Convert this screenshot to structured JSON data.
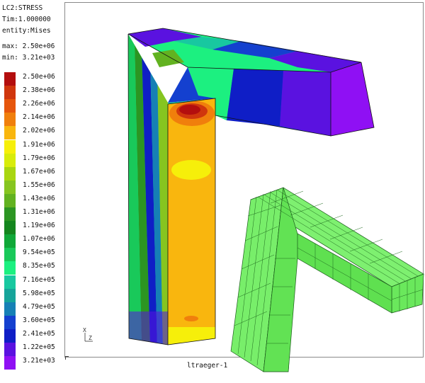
{
  "header": {
    "loadcase": "LC2:STRESS",
    "time": "Tim:1.000000",
    "entity": "entity:Mises",
    "max": "max: 2.50e+06",
    "min": "min: 3.21e+03"
  },
  "legend": {
    "items": [
      {
        "label": "2.50e+06",
        "color": "#b30e0e"
      },
      {
        "label": "2.38e+06",
        "color": "#d0360d"
      },
      {
        "label": "2.26e+06",
        "color": "#e6560c"
      },
      {
        "label": "2.14e+06",
        "color": "#f07f0c"
      },
      {
        "label": "2.02e+06",
        "color": "#f9b60e"
      },
      {
        "label": "1.91e+06",
        "color": "#f6ef0a"
      },
      {
        "label": "1.79e+06",
        "color": "#d8ec0a"
      },
      {
        "label": "1.67e+06",
        "color": "#a9d610"
      },
      {
        "label": "1.55e+06",
        "color": "#86c520"
      },
      {
        "label": "1.43e+06",
        "color": "#62b220"
      },
      {
        "label": "1.31e+06",
        "color": "#2c9522"
      },
      {
        "label": "1.19e+06",
        "color": "#14861e"
      },
      {
        "label": "1.07e+06",
        "color": "#10a838"
      },
      {
        "label": "9.54e+05",
        "color": "#19c95a"
      },
      {
        "label": "8.35e+05",
        "color": "#1cf080"
      },
      {
        "label": "7.16e+05",
        "color": "#18c8a0"
      },
      {
        "label": "5.98e+05",
        "color": "#16a49a"
      },
      {
        "label": "4.79e+05",
        "color": "#1680b5"
      },
      {
        "label": "3.60e+05",
        "color": "#1440cf"
      },
      {
        "label": "2.41e+05",
        "color": "#0f1ec6"
      },
      {
        "label": "1.22e+05",
        "color": "#5a12e0"
      },
      {
        "label": "3.21e+03",
        "color": "#8f10f4"
      }
    ]
  },
  "viewport": {
    "model_name": "ltraeger-1",
    "axis_x": "X",
    "axis_y": "Z"
  }
}
